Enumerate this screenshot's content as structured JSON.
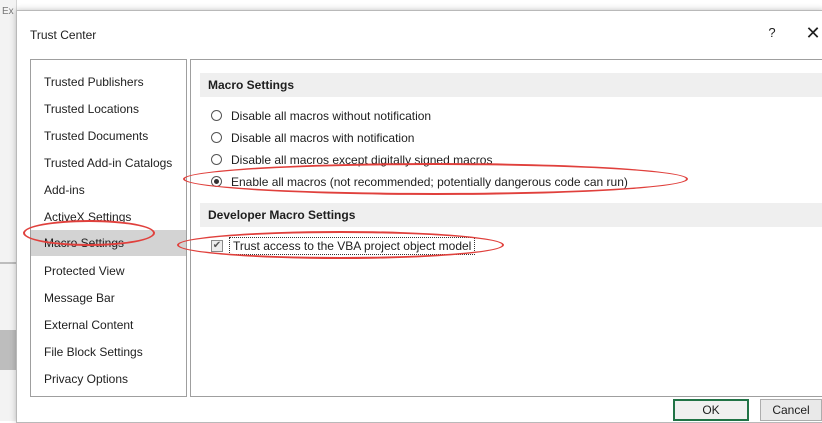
{
  "background_app": {
    "partial_text": "Ex"
  },
  "dialog": {
    "title": "Trust Center",
    "help_label": "?",
    "close_label": "✕"
  },
  "sidebar": {
    "items": [
      {
        "label": "Trusted Publishers"
      },
      {
        "label": "Trusted Locations"
      },
      {
        "label": "Trusted Documents"
      },
      {
        "label": "Trusted Add-in Catalogs"
      },
      {
        "label": "Add-ins"
      },
      {
        "label": "ActiveX Settings"
      },
      {
        "label": "Macro Settings",
        "selected": true
      },
      {
        "label": "Protected View"
      },
      {
        "label": "Message Bar"
      },
      {
        "label": "External Content"
      },
      {
        "label": "File Block Settings"
      },
      {
        "label": "Privacy Options"
      }
    ]
  },
  "macro_settings": {
    "header": "Macro Settings",
    "options": [
      {
        "label": "Disable all macros without notification",
        "checked": false
      },
      {
        "label": "Disable all macros with notification",
        "checked": false
      },
      {
        "label": "Disable all macros except digitally signed macros",
        "checked": false
      },
      {
        "label": "Enable all macros (not recommended; potentially dangerous code can run)",
        "checked": true
      }
    ]
  },
  "developer_macro_settings": {
    "header": "Developer Macro Settings",
    "trust_vba_label": "Trust access to the VBA project object model",
    "trust_vba_checked": true
  },
  "buttons": {
    "ok_label": "OK",
    "cancel_label": "Cancel"
  },
  "colors": {
    "annotation": "#e0403c",
    "default_button_border": "#217346",
    "selected_item": "#d3d3d3"
  }
}
